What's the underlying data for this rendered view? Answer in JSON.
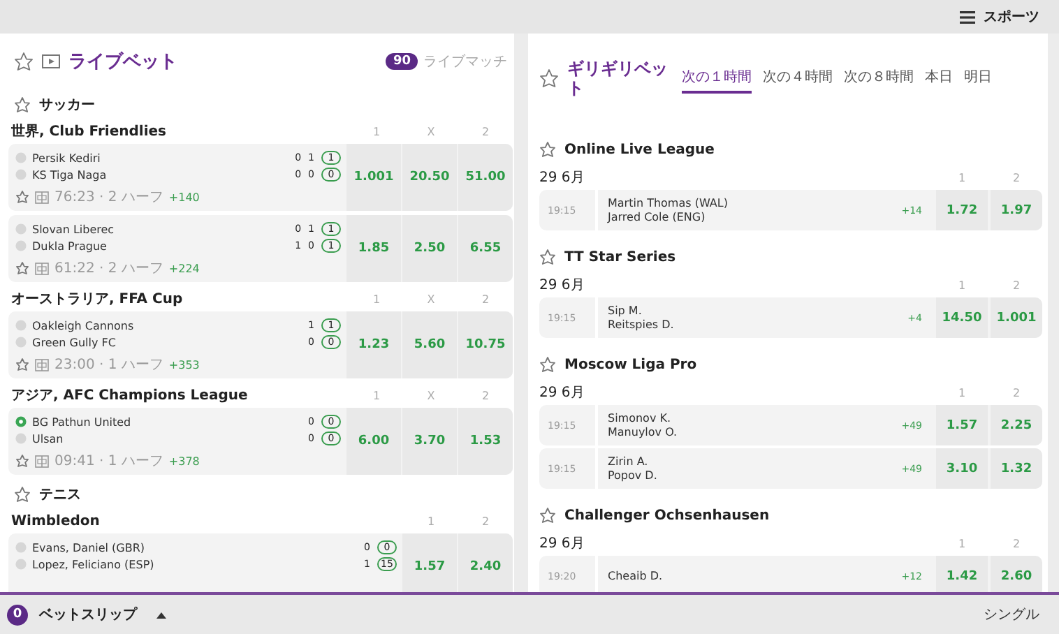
{
  "top_bar": {
    "menu_label": "スポーツ"
  },
  "live": {
    "title": "ライブベット",
    "count": "90",
    "count_label": "ライブマッチ",
    "sports": [
      {
        "name": "サッカー",
        "competitions": [
          {
            "name": "世界, Club Friendlies",
            "headers": [
              "1",
              "X",
              "2"
            ],
            "matches": [
              {
                "teams": [
                  {
                    "name": "Persik Kediri",
                    "has_logo": false,
                    "scores": [
                      "0",
                      "1"
                    ],
                    "current": "1"
                  },
                  {
                    "name": "KS Tiga Naga",
                    "has_logo": false,
                    "scores": [
                      "0",
                      "0"
                    ],
                    "current": "0"
                  }
                ],
                "meta": "76:23 · 2 ハーフ",
                "more": "+140",
                "odds": [
                  "1.001",
                  "20.50",
                  "51.00"
                ]
              },
              {
                "teams": [
                  {
                    "name": "Slovan Liberec",
                    "has_logo": false,
                    "scores": [
                      "0",
                      "1"
                    ],
                    "current": "1"
                  },
                  {
                    "name": "Dukla Prague",
                    "has_logo": false,
                    "scores": [
                      "1",
                      "0"
                    ],
                    "current": "1"
                  }
                ],
                "meta": "61:22 · 2 ハーフ",
                "more": "+224",
                "odds": [
                  "1.85",
                  "2.50",
                  "6.55"
                ]
              }
            ]
          },
          {
            "name": "オーストラリア, FFA Cup",
            "headers": [
              "1",
              "X",
              "2"
            ],
            "matches": [
              {
                "teams": [
                  {
                    "name": "Oakleigh Cannons",
                    "has_logo": false,
                    "scores": [
                      "1"
                    ],
                    "current": "1"
                  },
                  {
                    "name": "Green Gully FC",
                    "has_logo": false,
                    "scores": [
                      "0"
                    ],
                    "current": "0"
                  }
                ],
                "meta": "23:00 · 1 ハーフ",
                "more": "+353",
                "odds": [
                  "1.23",
                  "5.60",
                  "10.75"
                ]
              }
            ]
          },
          {
            "name": "アジア, AFC Champions League",
            "headers": [
              "1",
              "X",
              "2"
            ],
            "matches": [
              {
                "teams": [
                  {
                    "name": "BG Pathun United",
                    "has_logo": true,
                    "scores": [
                      "0"
                    ],
                    "current": "0"
                  },
                  {
                    "name": "Ulsan",
                    "has_logo": false,
                    "scores": [
                      "0"
                    ],
                    "current": "0"
                  }
                ],
                "meta": "09:41 · 1 ハーフ",
                "more": "+378",
                "odds": [
                  "6.00",
                  "3.70",
                  "1.53"
                ]
              }
            ]
          }
        ]
      },
      {
        "name": "テニス",
        "competitions": [
          {
            "name": "Wimbledon",
            "headers": [
              "1",
              "2"
            ],
            "matches": [
              {
                "teams": [
                  {
                    "name": "Evans, Daniel (GBR)",
                    "has_logo": false,
                    "scores": [
                      "0"
                    ],
                    "current": "0"
                  },
                  {
                    "name": "Lopez, Feliciano (ESP)",
                    "has_logo": false,
                    "scores": [
                      "1"
                    ],
                    "current": "15"
                  }
                ],
                "odds": [
                  "1.57",
                  "2.40"
                ]
              }
            ]
          }
        ]
      }
    ]
  },
  "last_minute": {
    "title": "ギリギリベット",
    "tabs": [
      {
        "label": "次の１時間",
        "selected": true
      },
      {
        "label": "次の４時間",
        "selected": false
      },
      {
        "label": "次の８時間",
        "selected": false
      },
      {
        "label": "本日",
        "selected": false
      },
      {
        "label": "明日",
        "selected": false
      }
    ],
    "leagues": [
      {
        "name": "Online Live League",
        "date": "29 6月",
        "headers": [
          "1",
          "2"
        ],
        "matches": [
          {
            "time": "19:15",
            "players": [
              "Martin Thomas (WAL)",
              "Jarred Cole (ENG)"
            ],
            "more": "+14",
            "odds": [
              "1.72",
              "1.97"
            ]
          }
        ]
      },
      {
        "name": "TT Star Series",
        "date": "29 6月",
        "headers": [
          "1",
          "2"
        ],
        "matches": [
          {
            "time": "19:15",
            "players": [
              "Sip M.",
              "Reitspies D."
            ],
            "more": "+4",
            "odds": [
              "14.50",
              "1.001"
            ]
          }
        ]
      },
      {
        "name": "Moscow Liga Pro",
        "date": "29 6月",
        "headers": [
          "1",
          "2"
        ],
        "matches": [
          {
            "time": "19:15",
            "players": [
              "Simonov K.",
              "Manuylov O."
            ],
            "more": "+49",
            "odds": [
              "1.57",
              "2.25"
            ]
          },
          {
            "time": "19:15",
            "players": [
              "Zirin A.",
              "Popov D."
            ],
            "more": "+49",
            "odds": [
              "3.10",
              "1.32"
            ]
          }
        ]
      },
      {
        "name": "Challenger Ochsenhausen",
        "date": "29 6月",
        "headers": [
          "1",
          "2"
        ],
        "matches": [
          {
            "time": "19:20",
            "players": [
              "Cheaib D."
            ],
            "more": "+12",
            "odds": [
              "1.42",
              "2.60"
            ]
          }
        ]
      }
    ]
  },
  "bet_slip": {
    "count": "0",
    "label": "ベットスリップ",
    "mode": "シングル"
  }
}
